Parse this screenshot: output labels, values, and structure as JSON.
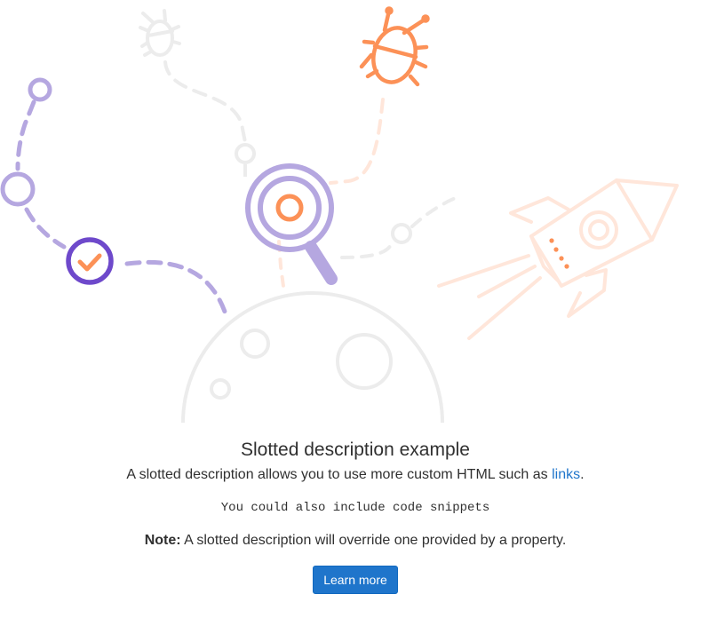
{
  "empty_state": {
    "illustration_name": "empty-search-illustration",
    "title": "Slotted description example",
    "description_prefix": "A slotted description allows you to use more custom HTML such as ",
    "description_link": "links",
    "description_suffix": ".",
    "code_snippet": "You could also include code snippets",
    "note_label": "Note:",
    "note_text": " A slotted description will override one provided by a property.",
    "primary_button_label": "Learn more"
  },
  "colors": {
    "purple_light": "#b5a7e0",
    "purple_dark": "#6e49cb",
    "orange": "#fc9157",
    "orange_light": "#ffe6da",
    "gray_light": "#ececec",
    "link_blue": "#1f75cb",
    "button_blue": "#1f75cb"
  }
}
